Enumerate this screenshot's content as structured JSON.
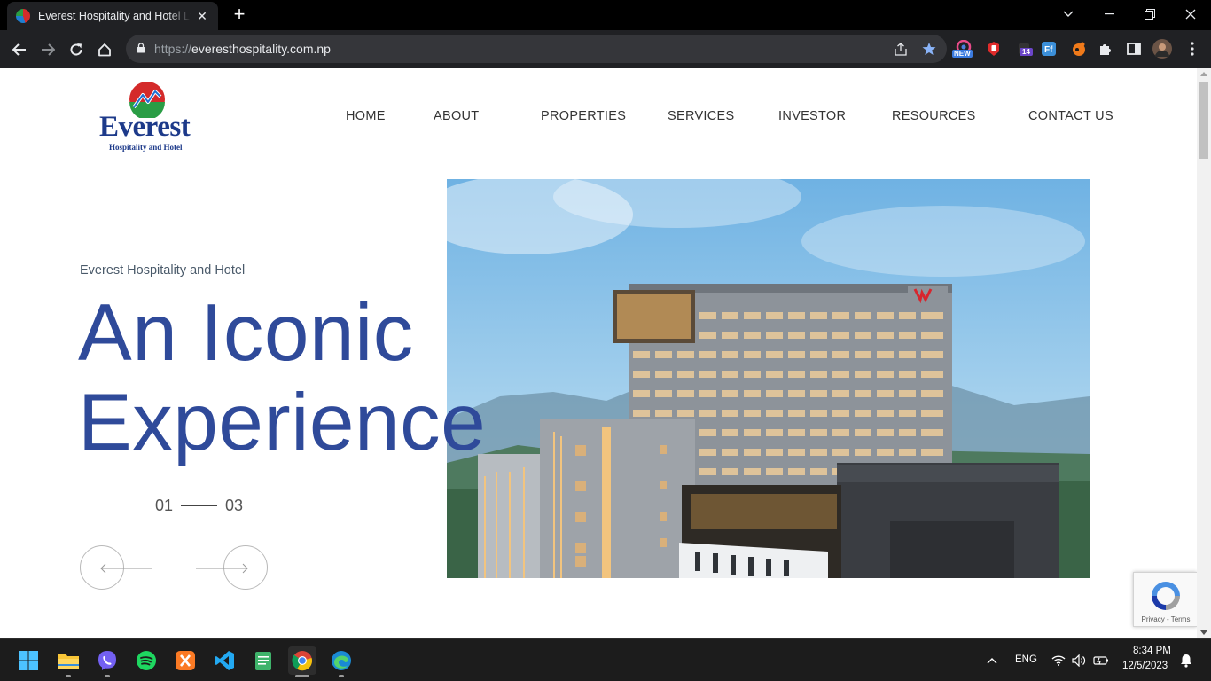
{
  "browser": {
    "tab": {
      "title": "Everest Hospitality and Hotel Ltd",
      "close_label": "✕"
    },
    "new_tab_label": "+",
    "window_controls": {
      "dropdown": "⌄",
      "minimize": "—",
      "restore": "❐",
      "close": "✕"
    },
    "url": {
      "scheme": "https://",
      "host": "everesthospitality.com.np"
    },
    "extension_badges": {
      "new": "NEW",
      "count": "14"
    }
  },
  "site": {
    "logo": {
      "name": "Everest",
      "tagline": "Hospitality and Hotel"
    },
    "nav": [
      "HOME",
      "ABOUT",
      "PROPERTIES",
      "SERVICES",
      "INVESTOR",
      "RESOURCES",
      "CONTACT US"
    ],
    "hero": {
      "eyebrow": "Everest Hospitality and Hotel",
      "title_line1": "An Iconic",
      "title_line2": "Experience",
      "slide_current": "01",
      "slide_total": "03"
    },
    "recaptcha": {
      "text": "Privacy - Terms"
    }
  },
  "taskbar": {
    "apps": [
      "windows-start",
      "file-explorer",
      "viber",
      "spotify",
      "xampp",
      "vscode",
      "notepad",
      "chrome",
      "edge"
    ],
    "tray": {
      "language": "ENG",
      "time": "8:34 PM",
      "date": "12/5/2023"
    }
  }
}
